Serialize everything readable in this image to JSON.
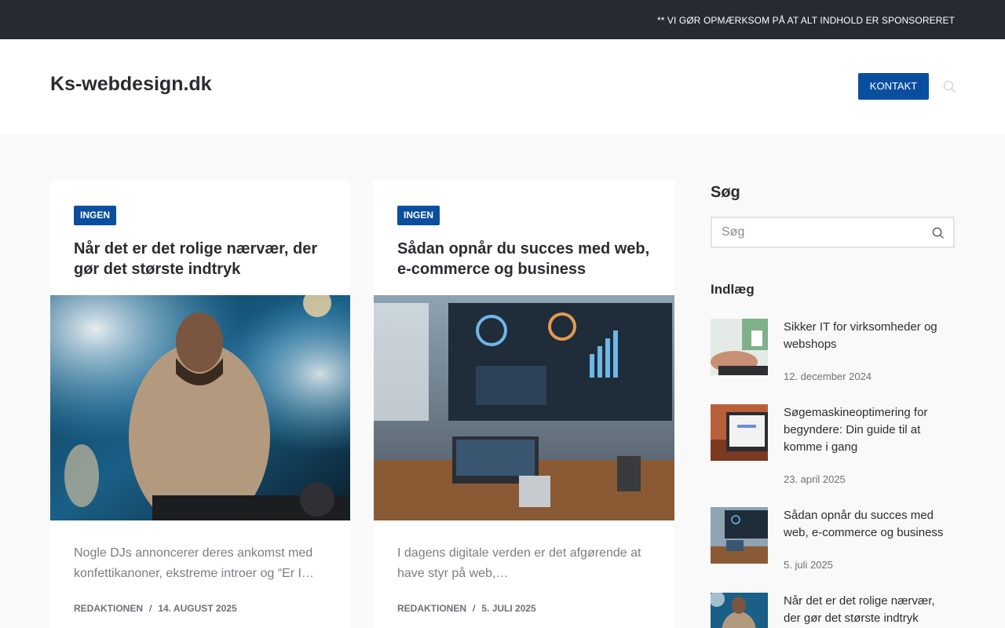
{
  "topbar": {
    "notice": "** VI GØR OPMÆRKSOM PÅ AT ALT INDHOLD ER SPONSORERET"
  },
  "header": {
    "site_title": "Ks-webdesign.dk",
    "contact_label": "KONTAKT",
    "search_icon": "search-icon"
  },
  "articles": [
    {
      "category": "INGEN",
      "title": "Når det er det rolige nærvær, der gør det største indtryk",
      "excerpt": "Nogle DJs annoncerer deres ankomst med konfettikanoner, ekstreme introer og “Er I…",
      "author": "REDAKTIONEN",
      "date": "14. AUGUST 2025"
    },
    {
      "category": "INGEN",
      "title": "Sådan opnår du succes med web, e-commerce og business",
      "excerpt": "I dagens digitale verden er det afgørende at have styr på web,…",
      "author": "REDAKTIONEN",
      "date": "5. JULI 2025"
    }
  ],
  "sidebar": {
    "search_heading": "Søg",
    "search_placeholder": "Søg",
    "posts_heading": "Indlæg",
    "posts": [
      {
        "title": "Sikker IT for virksomheder og webshops",
        "date": "12. december 2024"
      },
      {
        "title": "Søgemaskineoptimering for begyndere: Din guide til at komme i gang",
        "date": "23. april 2025"
      },
      {
        "title": "Sådan opnår du succes med web, e-commerce og business",
        "date": "5. juli 2025"
      },
      {
        "title": "Når det er det rolige nærvær, der gør det største indtryk",
        "date": ""
      }
    ]
  },
  "colors": {
    "accent": "#0a4f9f",
    "topbar": "#262b33",
    "text": "#2a2c32",
    "muted": "#7a7d82"
  }
}
